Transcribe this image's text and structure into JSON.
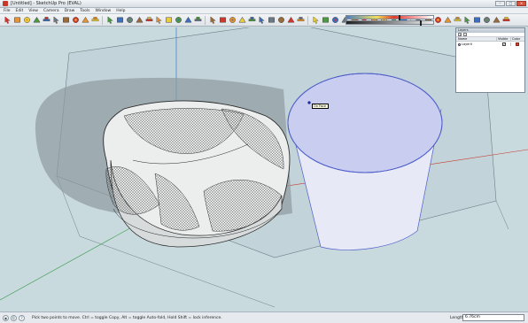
{
  "window": {
    "title": "[Untitled] - SketchUp Pro (EVAL)",
    "controls": {
      "minimize": "–",
      "maximize": "□",
      "close": "×"
    }
  },
  "menu": [
    "File",
    "Edit",
    "View",
    "Camera",
    "Draw",
    "Tools",
    "Window",
    "Help"
  ],
  "toolbar": {
    "tools": [
      "select-arrow-icon",
      "rectangle-icon",
      "line-pencil-icon",
      "circle-icon",
      "arc-icon",
      "polygon-icon",
      "freehand-icon",
      "eraser-icon",
      "paint-bucket-icon",
      "push-pull-icon",
      "follow-me-icon",
      "move-icon",
      "rotate-icon",
      "scale-icon",
      "offset-icon",
      "tape-measure-icon",
      "dimension-icon",
      "protractor-icon",
      "text-icon",
      "axes-icon",
      "3d-text-icon",
      "orbit-icon",
      "pan-icon",
      "zoom-icon",
      "zoom-window-icon",
      "zoom-extents-icon",
      "previous-view-icon",
      "next-view-icon",
      "position-camera-icon",
      "walk-icon",
      "look-around-icon",
      "section-plane-icon",
      "iso-view-icon",
      "top-view-icon",
      "front-view-icon",
      "right-view-icon",
      "back-view-icon",
      "left-view-icon",
      "xray-icon",
      "wireframe-icon",
      "hidden-line-icon",
      "shaded-icon",
      "shaded-texture-icon",
      "monochrome-icon",
      "shadows-icon",
      "fog-icon",
      "get-models-icon",
      "share-model-icon",
      "components-icon",
      "add-location-icon"
    ],
    "colors": {
      "red": "#d8352a",
      "orange": "#e8932e",
      "yellow": "#e9cd3c",
      "green": "#4b9a3e",
      "blue": "#3c6fbf",
      "gray": "#6c7884",
      "brown": "#9b6a3a"
    }
  },
  "shadow_settings": {
    "time_position": 0.6,
    "light_position": 0.85
  },
  "viewport": {
    "background": "#c9dadf",
    "axis_colors": {
      "red": "#c93a2f",
      "green": "#3a9a4a",
      "blue": "#2e7fc6"
    },
    "cylinder_fill": "#c7ccf0",
    "cylinder_edge": "#4f5fc9"
  },
  "tooltip": {
    "text": "On Face"
  },
  "layers_panel": {
    "title": "Layers",
    "add_label": "+",
    "remove_label": "−",
    "columns": {
      "name": "Name",
      "visible": "Visible",
      "color": "Color"
    },
    "rows": [
      {
        "name": "Layer0",
        "visible": "✓",
        "color": "#e43d2f"
      }
    ]
  },
  "status": {
    "icons": [
      "geo-location-icon",
      "credits-icon",
      "help-icon"
    ],
    "message": "Pick two points to move.  Ctrl = toggle Copy, Alt = toggle Auto-fold, Hold Shift = lock inference.",
    "measure_label": "Length",
    "measure_value": "6.76cm"
  }
}
